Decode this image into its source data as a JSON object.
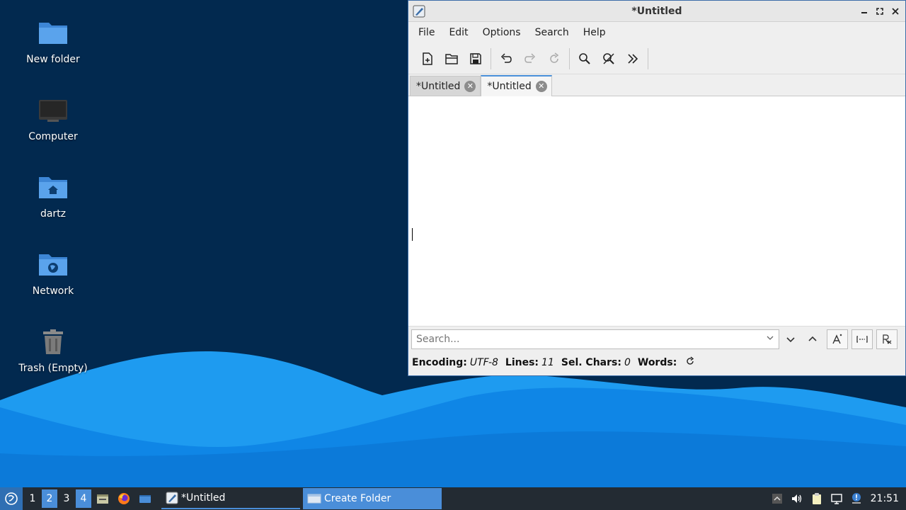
{
  "desktop": {
    "icons": [
      {
        "label": "New folder"
      },
      {
        "label": "Computer"
      },
      {
        "label": "dartz"
      },
      {
        "label": "Network"
      },
      {
        "label": "Trash (Empty)"
      }
    ]
  },
  "window": {
    "title": "*Untitled",
    "menu": [
      "File",
      "Edit",
      "Options",
      "Search",
      "Help"
    ],
    "tabs": [
      {
        "label": "*Untitled",
        "active": false
      },
      {
        "label": "*Untitled",
        "active": true
      }
    ],
    "search": {
      "placeholder": "Search...",
      "value": ""
    },
    "status": {
      "encoding_label": "Encoding:",
      "encoding_value": "UTF-8",
      "lines_label": "Lines:",
      "lines_value": "11",
      "sel_label": "Sel. Chars:",
      "sel_value": "0",
      "words_label": "Words:"
    }
  },
  "taskbar": {
    "workspaces": [
      "1",
      "2",
      "3",
      "4"
    ],
    "active_workspaces": [
      "2",
      "4"
    ],
    "tasks": [
      {
        "label": "*Untitled"
      },
      {
        "label": "Create Folder"
      }
    ],
    "clock": "21:51"
  },
  "colors": {
    "desktop_bg": "#02294f",
    "wave_light": "#1e9bf0",
    "wave_dark": "#0f7fe0",
    "accent": "#4a8ed9",
    "taskbar_bg": "#232b33"
  }
}
